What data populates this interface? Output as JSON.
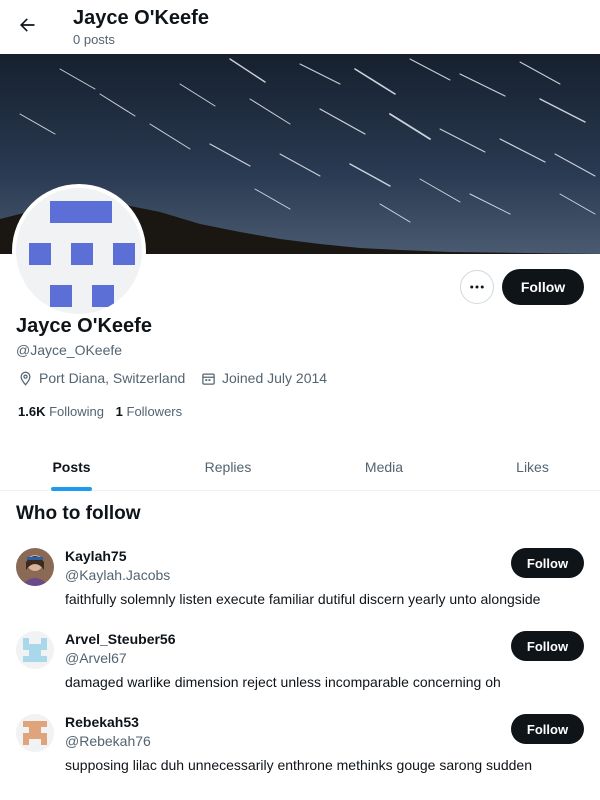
{
  "header": {
    "title": "Jayce O'Keefe",
    "post_count": "0 posts",
    "back_icon": "arrow-left-icon"
  },
  "profile": {
    "name": "Jayce O'Keefe",
    "handle": "@Jayce_OKeefe",
    "location": "Port Diana, Switzerland",
    "joined": "Joined July 2014",
    "following_count": "1.6K",
    "following_label": "Following",
    "followers_count": "1",
    "followers_label": "Followers",
    "follow_label": "Follow",
    "more_icon": "more-icon",
    "avatar_color": "#5b6fd6"
  },
  "tabs": [
    {
      "label": "Posts",
      "active": true
    },
    {
      "label": "Replies",
      "active": false
    },
    {
      "label": "Media",
      "active": false
    },
    {
      "label": "Likes",
      "active": false
    }
  ],
  "who_to_follow": {
    "title": "Who to follow",
    "items": [
      {
        "name": "Kaylah75",
        "handle": "@Kaylah.Jacobs",
        "bio": "faithfully solemnly listen execute familiar dutiful discern yearly unto alongside",
        "follow_label": "Follow"
      },
      {
        "name": "Arvel_Steuber56",
        "handle": "@Arvel67",
        "bio": "damaged warlike dimension reject unless incomparable concerning oh",
        "follow_label": "Follow",
        "avatar_color": "#a8d8ea"
      },
      {
        "name": "Rebekah53",
        "handle": "@Rebekah76",
        "bio": "supposing lilac duh unnecessarily enthrone methinks gouge sarong sudden",
        "follow_label": "Follow",
        "avatar_color": "#e0a47c"
      }
    ]
  },
  "colors": {
    "accent": "#1d9bf0",
    "button": "#0f1419",
    "muted": "#536471"
  }
}
